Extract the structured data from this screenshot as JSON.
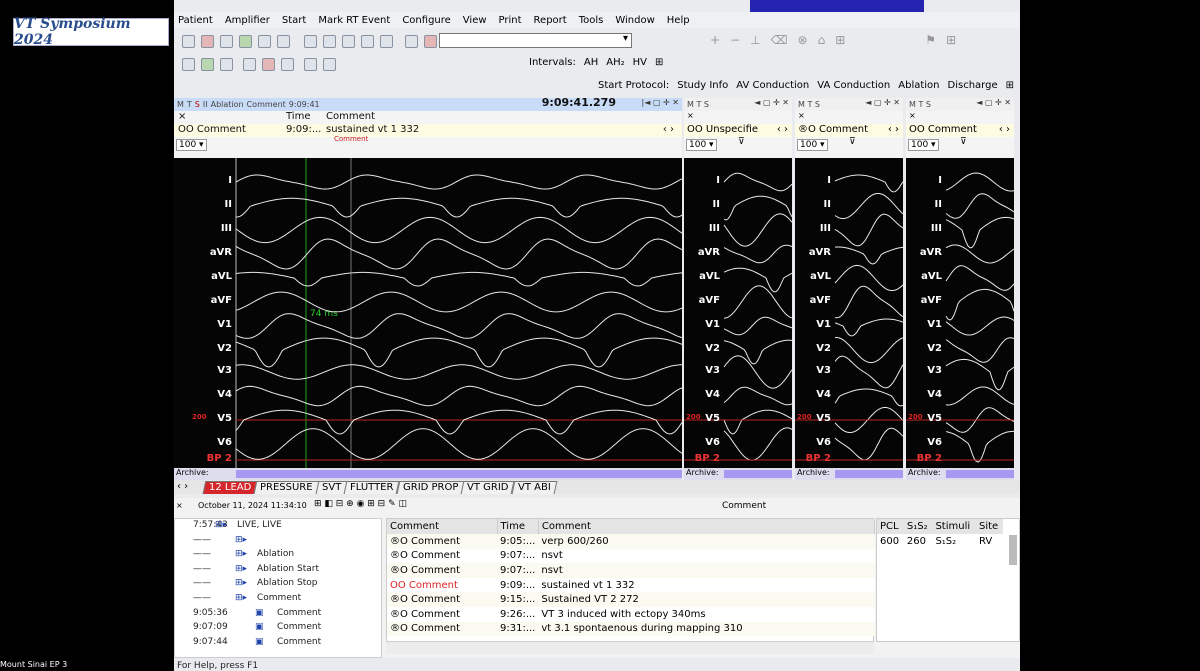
{
  "badge": "VT Symposium 2024",
  "taskbar_label": "Mount Sinai EP 3",
  "menu": [
    "Patient",
    "Amplifier",
    "Start",
    "Mark RT Event",
    "Configure",
    "View",
    "Print",
    "Report",
    "Tools",
    "Window",
    "Help"
  ],
  "intervals": {
    "label": "Intervals:",
    "items": [
      "AH",
      "AH₂",
      "HV"
    ]
  },
  "protocol": {
    "label": "Start Protocol:",
    "items": [
      "Study Info",
      "AV Conduction",
      "VA Conduction",
      "Ablation",
      "Discharge"
    ]
  },
  "main_pane": {
    "title_items": [
      "M",
      "T",
      "S",
      "II",
      "Ablation",
      "Comment",
      "9:09:41"
    ],
    "clock": "9:09:41.279",
    "col_time": "Time",
    "col_comment": "Comment",
    "row_label": "OO Comment",
    "row_time": "9:09:...",
    "row_comment": "sustained vt 1 332",
    "gain": "100",
    "marker": "Comment",
    "measure": "74 ms"
  },
  "side_panes": [
    {
      "title": "OO Unspecifie",
      "gain": "100"
    },
    {
      "title": "®O Comment",
      "gain": "100"
    },
    {
      "title": "OO Comment",
      "gain": "100"
    }
  ],
  "leads": [
    "I",
    "II",
    "III",
    "aVR",
    "aVL",
    "aVF",
    "V1",
    "V2",
    "V3",
    "V4",
    "V5",
    "V6",
    "BP 2"
  ],
  "scale_marker": "200",
  "archive_label": "Archive:",
  "tabs": [
    "12 LEAD",
    "PRESSURE",
    "SVT",
    "FLUTTER",
    "GRID PROP",
    "VT GRID",
    "VT ABI"
  ],
  "bottom": {
    "date": "October 11, 2024 11:34:10",
    "header_right": "Comment",
    "tree": [
      {
        "time": "7:57:43",
        "label": "LIVE, LIVE"
      },
      {
        "time": "——",
        "label": ""
      },
      {
        "time": "——",
        "label": "Ablation"
      },
      {
        "time": "——",
        "label": "Ablation Start"
      },
      {
        "time": "——",
        "label": "Ablation Stop"
      },
      {
        "time": "——",
        "label": "Comment"
      },
      {
        "time": "9:05:36",
        "label": "Comment"
      },
      {
        "time": "9:07:09",
        "label": "Comment"
      },
      {
        "time": "9:07:44",
        "label": "Comment"
      }
    ],
    "log_headers": [
      "Comment",
      "Time",
      "Comment"
    ],
    "log_rows": [
      {
        "type": "®O Comment",
        "time": "9:05:...",
        "text": "verp 600/260",
        "highlight": false
      },
      {
        "type": "®O Comment",
        "time": "9:07:...",
        "text": "nsvt",
        "highlight": false
      },
      {
        "type": "®O Comment",
        "time": "9:07:...",
        "text": "nsvt",
        "highlight": false
      },
      {
        "type": "OO Comment",
        "time": "9:09:...",
        "text": "sustained vt 1 332",
        "highlight": true
      },
      {
        "type": "®O Comment",
        "time": "9:15:...",
        "text": "Sustained VT 2 272",
        "highlight": false
      },
      {
        "type": "®O Comment",
        "time": "9:26:...",
        "text": "VT 3 induced with ectopy 340ms",
        "highlight": false
      },
      {
        "type": "®O Comment",
        "time": "9:31:...",
        "text": "vt 3.1 spontaenous during mapping 310",
        "highlight": false
      }
    ],
    "stim_headers": [
      "PCL",
      "S₁S₂",
      "Stimuli",
      "Site"
    ],
    "stim_row": [
      "600",
      "260",
      "S₁S₂",
      "RV"
    ]
  },
  "status": "For Help, press F1"
}
